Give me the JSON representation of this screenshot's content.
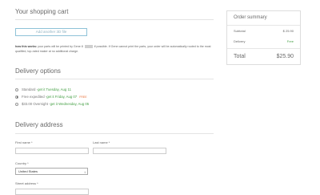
{
  "cart": {
    "title": "Your shopping cart",
    "add_button": "Add another 3D file",
    "note_bold": "how this works:",
    "note_text_1": "your parts will be printed by Gene 8",
    "note_text_2": "if possible. If Gene cannot print the parts, your order will be automatically routed to the most qualified, top-rated maker at no additional charge."
  },
  "delivery": {
    "title": "Delivery options",
    "options": [
      {
        "prefix": "Standard - ",
        "highlight": "get it Tuesday, Aug 11",
        "badge": "",
        "selected": false
      },
      {
        "prefix": "Free expedited - ",
        "highlight": "get it Friday, Aug 07",
        "badge": "FREE",
        "selected": true
      },
      {
        "prefix": "$33.00 Overnight - ",
        "highlight": "get it Wednesday, Aug 05",
        "badge": "",
        "selected": false
      }
    ]
  },
  "address": {
    "title": "Delivery address",
    "first_name_label": "First name *",
    "last_name_label": "Last name *",
    "country_label": "Country *",
    "country_value": "United States",
    "street_label": "Street address *"
  },
  "summary": {
    "title": "Order summary",
    "subtotal_label": "Subtotal",
    "subtotal_value": "$ 25.90",
    "delivery_label": "Delivery",
    "delivery_value": "Free",
    "total_label": "Total",
    "total_value": "$25.90"
  },
  "colors": {
    "accent_green": "#46a046",
    "free_badge": "#e8703a",
    "button_border": "#8fc3d8"
  }
}
